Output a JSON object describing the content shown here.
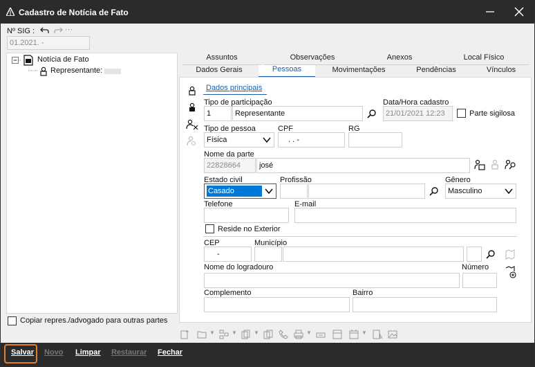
{
  "window": {
    "title": "Cadastro de Notícia de Fato"
  },
  "sig": {
    "label": "Nº SIG :",
    "value": "01.2021.      -"
  },
  "tree": {
    "root_label": "Notícia de Fato",
    "child_label": "Representante:"
  },
  "tabs_row1": [
    "Assuntos",
    "Observações",
    "Anexos",
    "Local Físico"
  ],
  "tabs_row2": [
    "Dados Gerais",
    "Pessoas",
    "Movimentações",
    "Pendências",
    "Vínculos"
  ],
  "subtab": "Dados principais",
  "form": {
    "tipo_participacao_label": "Tipo de participação",
    "tipo_participacao_code": "1",
    "tipo_participacao_value": "Representante",
    "data_hora_label": "Data/Hora cadastro",
    "data_hora_value": "21/01/2021 12:23",
    "parte_sigilosa_label": "Parte sigilosa",
    "tipo_pessoa_label": "Tipo de pessoa",
    "tipo_pessoa_value": "Física",
    "cpf_label": "CPF",
    "cpf_value": ".   .   -",
    "rg_label": "RG",
    "nome_parte_label": "Nome da parte",
    "nome_parte_code": "22828664",
    "nome_parte_value": "josé",
    "estado_civil_label": "Estado civil",
    "estado_civil_value": "Casado",
    "profissao_label": "Profissão",
    "genero_label": "Gênero",
    "genero_value": "Masculino",
    "telefone_label": "Telefone",
    "email_label": "E-mail",
    "reside_exterior_label": "Reside no Exterior",
    "cep_label": "CEP",
    "cep_value": "-",
    "municipio_label": "Município",
    "logradouro_label": "Nome do logradouro",
    "numero_label": "Número",
    "complemento_label": "Complemento",
    "bairro_label": "Bairro"
  },
  "copiar_label": "Copiar repres./advogado para outras partes",
  "bottom": {
    "salvar": "Salvar",
    "novo": "Novo",
    "limpar": "Limpar",
    "restaurar": "Restaurar",
    "fechar": "Fechar"
  }
}
